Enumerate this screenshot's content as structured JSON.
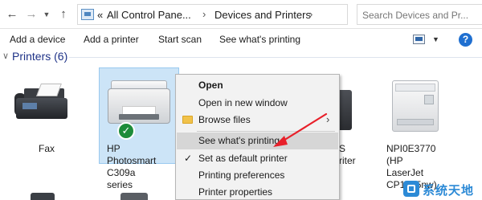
{
  "address_bar": {
    "prefix": "«",
    "crumbs": [
      "All Control Pane...",
      "Devices and Printers"
    ],
    "separator": "›",
    "search_placeholder": "Search Devices and Pr..."
  },
  "commands": [
    "Add a device",
    "Add a printer",
    "Start scan",
    "See what's printing"
  ],
  "group": {
    "title": "Printers (6)"
  },
  "devices": [
    {
      "label_lines": [
        "Fax"
      ],
      "icon": "fax-icon"
    },
    {
      "label_lines": [
        "HP Photosmart",
        "C309a series"
      ],
      "icon": "inkjet-printer-icon",
      "selected": true,
      "default": true
    },
    {
      "label_lines": [
        "S",
        "riter"
      ],
      "icon": "printer-icon"
    },
    {
      "label_lines": [
        "NPI0E3770 (HP",
        "LaserJet",
        "CP1525nw)"
      ],
      "icon": "laser-printer-icon"
    }
  ],
  "context_menu": {
    "items": [
      {
        "label": "Open",
        "bold": true
      },
      {
        "label": "Open in new window"
      },
      {
        "label": "Browse files",
        "icon": "folder-icon",
        "submenu": true
      },
      {
        "label": "See what's printing",
        "highlighted": true
      },
      {
        "label": "Set as default printer",
        "checked": true
      },
      {
        "label": "Printing preferences"
      },
      {
        "label": "Printer properties"
      }
    ]
  },
  "colors": {
    "group_title": "#1e3287",
    "selection": "#cce4f7",
    "help": "#1f6fd0",
    "annotation_arrow": "#e8202a",
    "watermark": "#2c8ad6"
  },
  "watermark": {
    "text": "系统天地"
  }
}
